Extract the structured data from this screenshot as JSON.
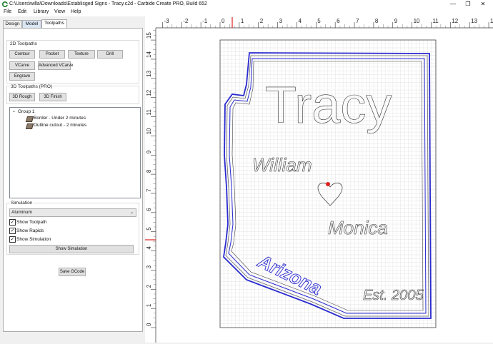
{
  "window": {
    "title": "C:\\Users\\willa\\Downloads\\Establisged Signs - Tracy.c2d - Carbide Create PRO, Build 652",
    "minimize": "—",
    "restore": "❐",
    "close": "✕"
  },
  "menu": [
    "File",
    "Edit",
    "Library",
    "View",
    "Help"
  ],
  "tabs": [
    "Design",
    "Model",
    "Toolpaths"
  ],
  "toolpaths_2d": {
    "label": "2D Toolpaths",
    "buttons": [
      "Contour",
      "Pocket",
      "Texture",
      "Drill",
      "VCarve",
      "Advanced VCarve",
      "Engrave"
    ]
  },
  "toolpaths_3d": {
    "label": "3D Toolpaths (PRO)",
    "buttons": [
      "3D Rough",
      "3D Finish"
    ]
  },
  "toolpath_tree": {
    "group": "Group 1",
    "items": [
      "Border - Under 2 minutes",
      "Outline cutout - 2 minutes"
    ]
  },
  "simulation": {
    "label": "Simulation",
    "material": "Aluminum",
    "show_toolpath": "Show Toolpath",
    "show_rapids": "Show Rapids",
    "show_simulation": "Show Simulation",
    "show_simulation_button": "Show Simulation"
  },
  "save_gcode": "Save GCode",
  "canvas": {
    "x_ticks": [
      "-3",
      "-2",
      "-1",
      "0",
      "1",
      "2",
      "3",
      "4",
      "5",
      "6",
      "7",
      "8",
      "9",
      "10",
      "11",
      "12",
      "13",
      "14"
    ],
    "y_ticks": [
      "15",
      "14",
      "13",
      "12",
      "11",
      "10",
      "9",
      "8",
      "7",
      "6",
      "5",
      "4",
      "3",
      "2",
      "1",
      "0"
    ],
    "texts": {
      "name": "Tracy",
      "left_name": "William",
      "right_name": "Monica",
      "state": "Arizona",
      "established": "Est. 2005"
    }
  },
  "colors": {
    "toolpath_blue": "#2a2ad0",
    "ruler_marker": "#e02020",
    "heart_marker": "#e02020"
  }
}
